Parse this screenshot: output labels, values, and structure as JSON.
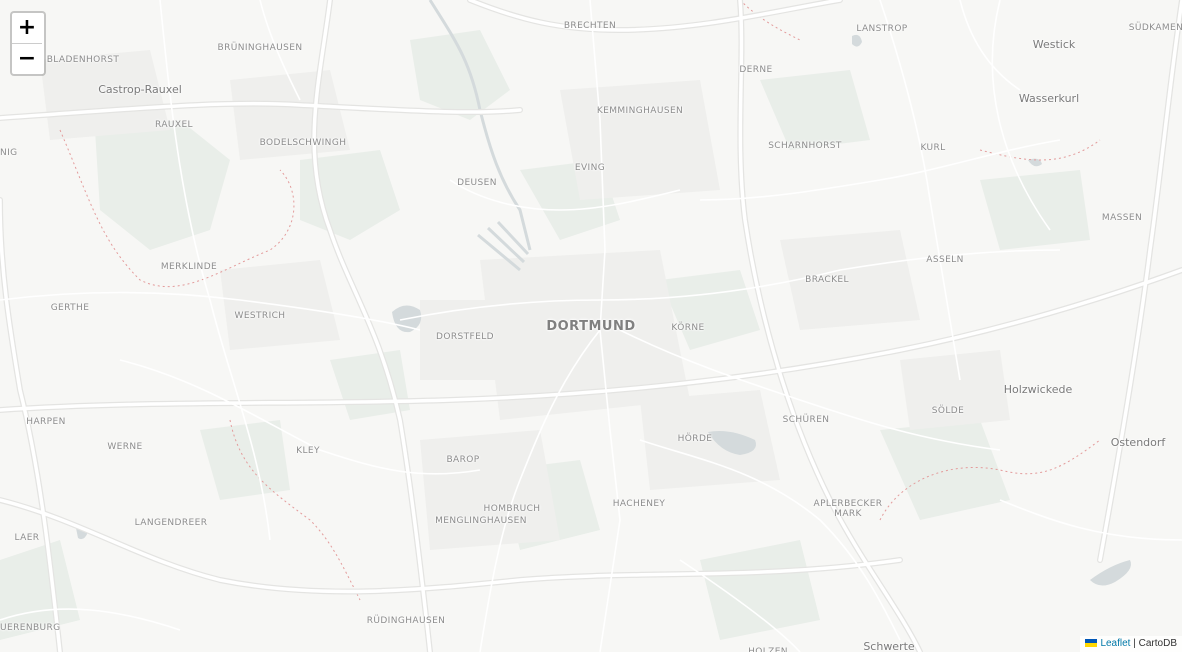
{
  "map": {
    "zoom_in_label": "+",
    "zoom_out_label": "−",
    "places": [
      {
        "id": "brechten",
        "label": "BRECHTEN",
        "kind": "suburb"
      },
      {
        "id": "lanstrop",
        "label": "LANSTROP",
        "kind": "suburb"
      },
      {
        "id": "westick",
        "label": "Westick",
        "kind": "town"
      },
      {
        "id": "sudkamen",
        "label": "SÜDKAMEN",
        "kind": "suburb"
      },
      {
        "id": "bruninghausen",
        "label": "BRÜNINGHAUSEN",
        "kind": "suburb"
      },
      {
        "id": "bladenhorst",
        "label": "BLADENHORST",
        "kind": "suburb"
      },
      {
        "id": "derne",
        "label": "DERNE",
        "kind": "suburb"
      },
      {
        "id": "castrop-rauxel",
        "label": "Castrop-Rauxel",
        "kind": "town"
      },
      {
        "id": "wasserkurl",
        "label": "Wasserkurl",
        "kind": "town"
      },
      {
        "id": "kemminghausen",
        "label": "KEMMINGHAUSEN",
        "kind": "suburb"
      },
      {
        "id": "rauxel",
        "label": "RAUXEL",
        "kind": "suburb"
      },
      {
        "id": "bodelschwingh",
        "label": "BODELSCHWINGH",
        "kind": "suburb"
      },
      {
        "id": "scharnhorst",
        "label": "SCHARNHORST",
        "kind": "suburb"
      },
      {
        "id": "kurl",
        "label": "KURL",
        "kind": "suburb"
      },
      {
        "id": "nig",
        "label": "NIG",
        "kind": "suburb"
      },
      {
        "id": "evinge",
        "label": "EVING",
        "kind": "suburb"
      },
      {
        "id": "deusen",
        "label": "DEUSEN",
        "kind": "suburb"
      },
      {
        "id": "massen",
        "label": "MASSEN",
        "kind": "suburb"
      },
      {
        "id": "asseln",
        "label": "ASSELN",
        "kind": "suburb"
      },
      {
        "id": "merklinde",
        "label": "MERKLINDE",
        "kind": "suburb"
      },
      {
        "id": "brackel",
        "label": "BRACKEL",
        "kind": "suburb"
      },
      {
        "id": "gerthe",
        "label": "GERTHE",
        "kind": "suburb"
      },
      {
        "id": "westrich",
        "label": "WESTRICH",
        "kind": "suburb"
      },
      {
        "id": "dortmund",
        "label": "DORTMUND",
        "kind": "city"
      },
      {
        "id": "korne",
        "label": "KÖRNE",
        "kind": "suburb"
      },
      {
        "id": "dorstfeld",
        "label": "DORSTFELD",
        "kind": "suburb"
      },
      {
        "id": "holzwickede",
        "label": "Holzwickede",
        "kind": "town"
      },
      {
        "id": "solde",
        "label": "SÖLDE",
        "kind": "suburb"
      },
      {
        "id": "harpen",
        "label": "HARPEN",
        "kind": "suburb"
      },
      {
        "id": "schuren",
        "label": "SCHÜREN",
        "kind": "suburb"
      },
      {
        "id": "werne",
        "label": "WERNE",
        "kind": "suburb"
      },
      {
        "id": "horde",
        "label": "HÖRDE",
        "kind": "suburb"
      },
      {
        "id": "ostendorf",
        "label": "Ostendorf",
        "kind": "town"
      },
      {
        "id": "kley",
        "label": "KLEY",
        "kind": "suburb"
      },
      {
        "id": "barop",
        "label": "BAROP",
        "kind": "suburb"
      },
      {
        "id": "hacheney",
        "label": "HACHENEY",
        "kind": "suburb"
      },
      {
        "id": "aplerbecker-mark",
        "label": "APLERBECKER\nMARK",
        "kind": "suburb"
      },
      {
        "id": "hombruch",
        "label": "HOMBRUCH",
        "kind": "suburb"
      },
      {
        "id": "langendreer",
        "label": "LANGENDREER",
        "kind": "suburb"
      },
      {
        "id": "menglinghausen",
        "label": "MENGLINGHAUSEN",
        "kind": "suburb"
      },
      {
        "id": "laer",
        "label": "LAER",
        "kind": "suburb"
      },
      {
        "id": "rudinghausen",
        "label": "RÜDINGHAUSEN",
        "kind": "suburb"
      },
      {
        "id": "querenburg",
        "label": "UERENBURG",
        "kind": "suburb"
      },
      {
        "id": "schwerte",
        "label": "Schwerte",
        "kind": "town"
      },
      {
        "id": "holzen",
        "label": "HOLZEN",
        "kind": "suburb"
      }
    ]
  },
  "attribution": {
    "leaflet_label": "Leaflet",
    "separator": "|",
    "provider": "CartoDB",
    "flag_colors": [
      "#0057b7",
      "#ffd700"
    ]
  },
  "colors": {
    "land": "#f7f7f5",
    "road": "#ffffff",
    "road_casing": "#e4e4e2",
    "park": "#e9eee9",
    "water": "#d4dadc",
    "boundary": "#e39b9b"
  }
}
